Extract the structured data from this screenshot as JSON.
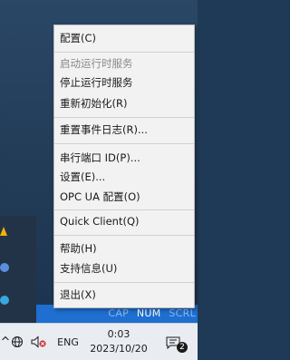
{
  "menu": {
    "items": [
      {
        "label": "配置(C)",
        "enabled": true
      },
      {
        "label": "启动运行时服务",
        "enabled": false
      },
      {
        "label": "停止运行时服务",
        "enabled": true
      },
      {
        "label": "重新初始化(R)",
        "enabled": true
      },
      {
        "label": "重置事件日志(R)...",
        "enabled": true
      },
      {
        "label": "串行端口 ID(P)...",
        "enabled": true
      },
      {
        "label": "设置(E)...",
        "enabled": true
      },
      {
        "label": "OPC UA 配置(O)",
        "enabled": true
      },
      {
        "label": "Quick Client(Q)",
        "enabled": true
      },
      {
        "label": "帮助(H)",
        "enabled": true
      },
      {
        "label": "支持信息(U)",
        "enabled": true
      },
      {
        "label": "退出(X)",
        "enabled": true
      }
    ]
  },
  "status_strip": {
    "keys": [
      "CAP",
      "NUM",
      "SCRL"
    ],
    "active": [
      "NUM"
    ]
  },
  "taskbar": {
    "chevron": "^",
    "language": "ENG",
    "time": "0:03",
    "date": "2023/10/20",
    "notification_count": "2"
  },
  "icons": {
    "globe": "globe-icon",
    "volume": "volume-muted-icon",
    "notification": "notification-center-icon"
  }
}
